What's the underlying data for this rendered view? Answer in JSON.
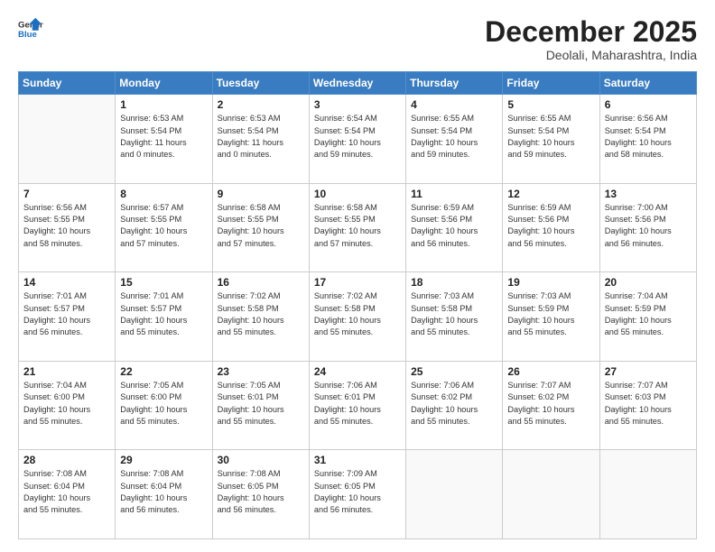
{
  "header": {
    "logo_general": "General",
    "logo_blue": "Blue",
    "month_title": "December 2025",
    "location": "Deolali, Maharashtra, India"
  },
  "days_of_week": [
    "Sunday",
    "Monday",
    "Tuesday",
    "Wednesday",
    "Thursday",
    "Friday",
    "Saturday"
  ],
  "weeks": [
    [
      {
        "day": "",
        "info": ""
      },
      {
        "day": "1",
        "info": "Sunrise: 6:53 AM\nSunset: 5:54 PM\nDaylight: 11 hours\nand 0 minutes."
      },
      {
        "day": "2",
        "info": "Sunrise: 6:53 AM\nSunset: 5:54 PM\nDaylight: 11 hours\nand 0 minutes."
      },
      {
        "day": "3",
        "info": "Sunrise: 6:54 AM\nSunset: 5:54 PM\nDaylight: 10 hours\nand 59 minutes."
      },
      {
        "day": "4",
        "info": "Sunrise: 6:55 AM\nSunset: 5:54 PM\nDaylight: 10 hours\nand 59 minutes."
      },
      {
        "day": "5",
        "info": "Sunrise: 6:55 AM\nSunset: 5:54 PM\nDaylight: 10 hours\nand 59 minutes."
      },
      {
        "day": "6",
        "info": "Sunrise: 6:56 AM\nSunset: 5:54 PM\nDaylight: 10 hours\nand 58 minutes."
      }
    ],
    [
      {
        "day": "7",
        "info": "Sunrise: 6:56 AM\nSunset: 5:55 PM\nDaylight: 10 hours\nand 58 minutes."
      },
      {
        "day": "8",
        "info": "Sunrise: 6:57 AM\nSunset: 5:55 PM\nDaylight: 10 hours\nand 57 minutes."
      },
      {
        "day": "9",
        "info": "Sunrise: 6:58 AM\nSunset: 5:55 PM\nDaylight: 10 hours\nand 57 minutes."
      },
      {
        "day": "10",
        "info": "Sunrise: 6:58 AM\nSunset: 5:55 PM\nDaylight: 10 hours\nand 57 minutes."
      },
      {
        "day": "11",
        "info": "Sunrise: 6:59 AM\nSunset: 5:56 PM\nDaylight: 10 hours\nand 56 minutes."
      },
      {
        "day": "12",
        "info": "Sunrise: 6:59 AM\nSunset: 5:56 PM\nDaylight: 10 hours\nand 56 minutes."
      },
      {
        "day": "13",
        "info": "Sunrise: 7:00 AM\nSunset: 5:56 PM\nDaylight: 10 hours\nand 56 minutes."
      }
    ],
    [
      {
        "day": "14",
        "info": "Sunrise: 7:01 AM\nSunset: 5:57 PM\nDaylight: 10 hours\nand 56 minutes."
      },
      {
        "day": "15",
        "info": "Sunrise: 7:01 AM\nSunset: 5:57 PM\nDaylight: 10 hours\nand 55 minutes."
      },
      {
        "day": "16",
        "info": "Sunrise: 7:02 AM\nSunset: 5:58 PM\nDaylight: 10 hours\nand 55 minutes."
      },
      {
        "day": "17",
        "info": "Sunrise: 7:02 AM\nSunset: 5:58 PM\nDaylight: 10 hours\nand 55 minutes."
      },
      {
        "day": "18",
        "info": "Sunrise: 7:03 AM\nSunset: 5:58 PM\nDaylight: 10 hours\nand 55 minutes."
      },
      {
        "day": "19",
        "info": "Sunrise: 7:03 AM\nSunset: 5:59 PM\nDaylight: 10 hours\nand 55 minutes."
      },
      {
        "day": "20",
        "info": "Sunrise: 7:04 AM\nSunset: 5:59 PM\nDaylight: 10 hours\nand 55 minutes."
      }
    ],
    [
      {
        "day": "21",
        "info": "Sunrise: 7:04 AM\nSunset: 6:00 PM\nDaylight: 10 hours\nand 55 minutes."
      },
      {
        "day": "22",
        "info": "Sunrise: 7:05 AM\nSunset: 6:00 PM\nDaylight: 10 hours\nand 55 minutes."
      },
      {
        "day": "23",
        "info": "Sunrise: 7:05 AM\nSunset: 6:01 PM\nDaylight: 10 hours\nand 55 minutes."
      },
      {
        "day": "24",
        "info": "Sunrise: 7:06 AM\nSunset: 6:01 PM\nDaylight: 10 hours\nand 55 minutes."
      },
      {
        "day": "25",
        "info": "Sunrise: 7:06 AM\nSunset: 6:02 PM\nDaylight: 10 hours\nand 55 minutes."
      },
      {
        "day": "26",
        "info": "Sunrise: 7:07 AM\nSunset: 6:02 PM\nDaylight: 10 hours\nand 55 minutes."
      },
      {
        "day": "27",
        "info": "Sunrise: 7:07 AM\nSunset: 6:03 PM\nDaylight: 10 hours\nand 55 minutes."
      }
    ],
    [
      {
        "day": "28",
        "info": "Sunrise: 7:08 AM\nSunset: 6:04 PM\nDaylight: 10 hours\nand 55 minutes."
      },
      {
        "day": "29",
        "info": "Sunrise: 7:08 AM\nSunset: 6:04 PM\nDaylight: 10 hours\nand 56 minutes."
      },
      {
        "day": "30",
        "info": "Sunrise: 7:08 AM\nSunset: 6:05 PM\nDaylight: 10 hours\nand 56 minutes."
      },
      {
        "day": "31",
        "info": "Sunrise: 7:09 AM\nSunset: 6:05 PM\nDaylight: 10 hours\nand 56 minutes."
      },
      {
        "day": "",
        "info": ""
      },
      {
        "day": "",
        "info": ""
      },
      {
        "day": "",
        "info": ""
      }
    ]
  ]
}
